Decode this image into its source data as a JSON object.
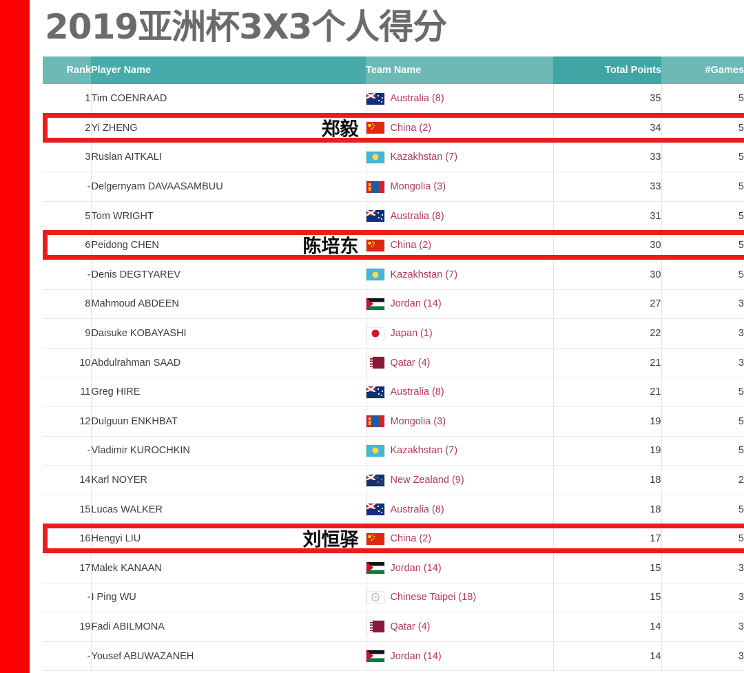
{
  "page": {
    "title": "2019亚洲杯3X3个人得分",
    "left_accent_color": "#fe0000",
    "highlight_border_color": "#ee1b1b",
    "header_colors": {
      "rank": "#6cb9b6",
      "player": "#47abaa",
      "team": "#6cb9b6",
      "points": "#3fa6a5",
      "games": "#6cb9b6"
    },
    "team_text_color": "#b23a5c",
    "title_color": "#6b6b6b"
  },
  "table": {
    "columns": [
      {
        "key": "rank",
        "label": "Rank"
      },
      {
        "key": "player",
        "label": "Player Name"
      },
      {
        "key": "team",
        "label": "Team Name"
      },
      {
        "key": "points",
        "label": "Total Points"
      },
      {
        "key": "games",
        "label": "#Games"
      }
    ],
    "rows": [
      {
        "rank": "1",
        "player": "Tim COENRAAD",
        "note": "",
        "team": "Australia (8)",
        "flag": "flag-au-icon",
        "points": "35",
        "games": "5",
        "highlight": false
      },
      {
        "rank": "2",
        "player": "Yi ZHENG",
        "note": "郑毅",
        "team": "China (2)",
        "flag": "flag-cn-icon",
        "points": "34",
        "games": "5",
        "highlight": true
      },
      {
        "rank": "3",
        "player": "Ruslan AITKALI",
        "note": "",
        "team": "Kazakhstan (7)",
        "flag": "flag-kz-icon",
        "points": "33",
        "games": "5",
        "highlight": false
      },
      {
        "rank": "-",
        "player": "Delgernyam DAVAASAMBUU",
        "note": "",
        "team": "Mongolia (3)",
        "flag": "flag-mn-icon",
        "points": "33",
        "games": "5",
        "highlight": false
      },
      {
        "rank": "5",
        "player": "Tom WRIGHT",
        "note": "",
        "team": "Australia (8)",
        "flag": "flag-au-icon",
        "points": "31",
        "games": "5",
        "highlight": false
      },
      {
        "rank": "6",
        "player": "Peidong CHEN",
        "note": "陈培东",
        "team": "China (2)",
        "flag": "flag-cn-icon",
        "points": "30",
        "games": "5",
        "highlight": true
      },
      {
        "rank": "-",
        "player": "Denis DEGTYAREV",
        "note": "",
        "team": "Kazakhstan (7)",
        "flag": "flag-kz-icon",
        "points": "30",
        "games": "5",
        "highlight": false
      },
      {
        "rank": "8",
        "player": "Mahmoud ABDEEN",
        "note": "",
        "team": "Jordan (14)",
        "flag": "flag-jo-icon",
        "points": "27",
        "games": "3",
        "highlight": false
      },
      {
        "rank": "9",
        "player": "Daisuke KOBAYASHI",
        "note": "",
        "team": "Japan (1)",
        "flag": "flag-jp-icon",
        "points": "22",
        "games": "3",
        "highlight": false
      },
      {
        "rank": "10",
        "player": "Abdulrahman SAAD",
        "note": "",
        "team": "Qatar (4)",
        "flag": "flag-qa-icon",
        "points": "21",
        "games": "3",
        "highlight": false
      },
      {
        "rank": "11",
        "player": "Greg HIRE",
        "note": "",
        "team": "Australia (8)",
        "flag": "flag-au-icon",
        "points": "21",
        "games": "5",
        "highlight": false
      },
      {
        "rank": "12",
        "player": "Dulguun ENKHBAT",
        "note": "",
        "team": "Mongolia (3)",
        "flag": "flag-mn-icon",
        "points": "19",
        "games": "5",
        "highlight": false
      },
      {
        "rank": "-",
        "player": "Vladimir KUROCHKIN",
        "note": "",
        "team": "Kazakhstan (7)",
        "flag": "flag-kz-icon",
        "points": "19",
        "games": "5",
        "highlight": false
      },
      {
        "rank": "14",
        "player": "Karl NOYER",
        "note": "",
        "team": "New Zealand (9)",
        "flag": "flag-nz-icon",
        "points": "18",
        "games": "2",
        "highlight": false
      },
      {
        "rank": "15",
        "player": "Lucas WALKER",
        "note": "",
        "team": "Australia (8)",
        "flag": "flag-au-icon",
        "points": "18",
        "games": "5",
        "highlight": false
      },
      {
        "rank": "16",
        "player": "Hengyi LIU",
        "note": "刘恒驿",
        "team": "China (2)",
        "flag": "flag-cn-icon",
        "points": "17",
        "games": "5",
        "highlight": true
      },
      {
        "rank": "17",
        "player": "Malek KANAAN",
        "note": "",
        "team": "Jordan (14)",
        "flag": "flag-jo-icon",
        "points": "15",
        "games": "3",
        "highlight": false
      },
      {
        "rank": "-",
        "player": "I Ping WU",
        "note": "",
        "team": "Chinese Taipei (18)",
        "flag": "flag-tw-icon",
        "points": "15",
        "games": "3",
        "highlight": false
      },
      {
        "rank": "19",
        "player": "Fadi ABILMONA",
        "note": "",
        "team": "Qatar (4)",
        "flag": "flag-qa-icon",
        "points": "14",
        "games": "3",
        "highlight": false
      },
      {
        "rank": "-",
        "player": "Yousef ABUWAZANEH",
        "note": "",
        "team": "Jordan (14)",
        "flag": "flag-jo-icon",
        "points": "14",
        "games": "3",
        "highlight": false
      }
    ]
  }
}
